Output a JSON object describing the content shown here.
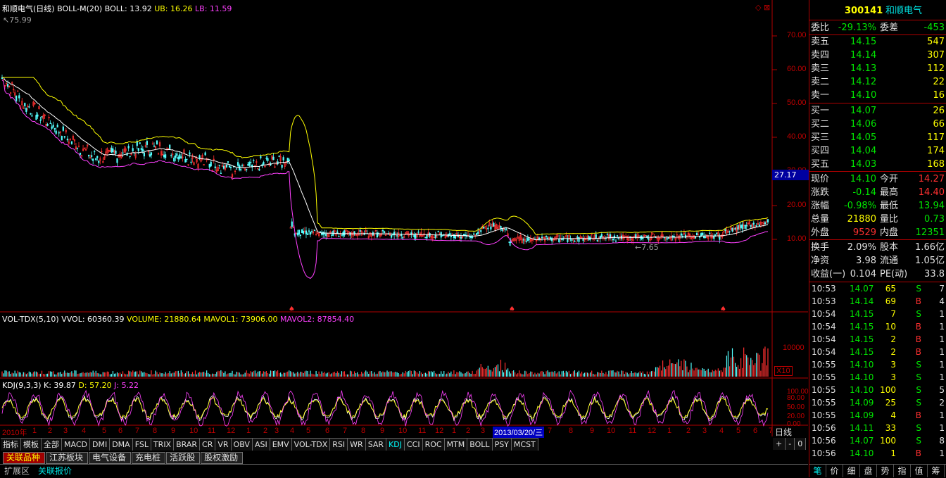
{
  "chart_header": {
    "name": "和顺电气(日线)",
    "indicator": "BOLL-M(20)",
    "boll_label": "BOLL:",
    "boll_value": "13.92",
    "ub_label": "UB:",
    "ub_value": "16.26",
    "lb_label": "LB:",
    "lb_value": "11.59",
    "high_marker": "75.99",
    "low_marker": "7.65",
    "current_price_tag": "27.17"
  },
  "price_axis": [
    "70.00",
    "60.00",
    "50.00",
    "40.00",
    "30.00",
    "20.00",
    "10.00"
  ],
  "vol_header": {
    "name": "VOL-TDX(5,10)",
    "vvol_label": "VVOL:",
    "vvol_value": "60360.39",
    "volume_label": "VOLUME:",
    "volume_value": "21880.64",
    "mavol1_label": "MAVOL1:",
    "mavol1_value": "73906.00",
    "mavol2_label": "MAVOL2:",
    "mavol2_value": "87854.40",
    "axis_value": "10000",
    "unit": "X10"
  },
  "kdj_header": {
    "name": "KDJ(9,3,3)",
    "k_label": "K:",
    "k_value": "39.87",
    "d_label": "D:",
    "d_value": "57.20",
    "j_label": "J:",
    "j_value": "5.22",
    "axis": [
      "100.00",
      "80.00",
      "50.00",
      "20.00",
      "0.00"
    ]
  },
  "time_axis": {
    "ticks": [
      "2010年",
      "1",
      "2",
      "3",
      "4",
      "5",
      "6",
      "7",
      "8",
      "9",
      "10",
      "11",
      "12",
      "1",
      "2",
      "3",
      "4",
      "5",
      "6",
      "7",
      "8",
      "9",
      "10",
      "11",
      "12",
      "1",
      "2",
      "3",
      "2013/03/20/三",
      "7",
      "8",
      "9",
      "10",
      "11",
      "12",
      "1",
      "2",
      "3",
      "4",
      "5",
      "6",
      "7"
    ],
    "period": "日线"
  },
  "indicator_tabs": [
    "指标",
    "模板",
    "全部",
    "MACD",
    "DMI",
    "DMA",
    "FSL",
    "TRIX",
    "BRAR",
    "CR",
    "VR",
    "OBV",
    "ASI",
    "EMV",
    "VOL-TDX",
    "RSI",
    "WR",
    "SAR",
    "KDJ",
    "CCI",
    "ROC",
    "MTM",
    "BOLL",
    "PSY",
    "MCST"
  ],
  "zoom_controls": [
    "+",
    "-",
    "0"
  ],
  "board_tabs": [
    "关联品种",
    "江苏板块",
    "电气设备",
    "充电桩",
    "活跃股",
    "股权激励"
  ],
  "footer_tabs": [
    "扩展区",
    "关联报价"
  ],
  "quote": {
    "code": "300141",
    "name": "和顺电气",
    "weibi_label": "委比",
    "weibi": "-29.13%",
    "weicha_label": "委差",
    "weicha": "-453",
    "sell": [
      {
        "label": "卖五",
        "price": "14.15",
        "vol": "547"
      },
      {
        "label": "卖四",
        "price": "14.14",
        "vol": "307"
      },
      {
        "label": "卖三",
        "price": "14.13",
        "vol": "112"
      },
      {
        "label": "卖二",
        "price": "14.12",
        "vol": "22"
      },
      {
        "label": "卖一",
        "price": "14.10",
        "vol": "16"
      }
    ],
    "buy": [
      {
        "label": "买一",
        "price": "14.07",
        "vol": "26"
      },
      {
        "label": "买二",
        "price": "14.06",
        "vol": "66"
      },
      {
        "label": "买三",
        "price": "14.05",
        "vol": "117"
      },
      {
        "label": "买四",
        "price": "14.04",
        "vol": "174"
      },
      {
        "label": "买五",
        "price": "14.03",
        "vol": "168"
      }
    ],
    "stats": [
      {
        "l1": "现价",
        "v1": "14.10",
        "c1": "#00e600",
        "l2": "今开",
        "v2": "14.27",
        "c2": "#ff3030"
      },
      {
        "l1": "涨跌",
        "v1": "-0.14",
        "c1": "#00e600",
        "l2": "最高",
        "v2": "14.40",
        "c2": "#ff3030"
      },
      {
        "l1": "涨幅",
        "v1": "-0.98%",
        "c1": "#00e600",
        "l2": "最低",
        "v2": "13.94",
        "c2": "#00e600"
      },
      {
        "l1": "总量",
        "v1": "21880",
        "c1": "#ffff00",
        "l2": "量比",
        "v2": "0.73",
        "c2": "#00e600"
      },
      {
        "l1": "外盘",
        "v1": "9529",
        "c1": "#ff3030",
        "l2": "内盘",
        "v2": "12351",
        "c2": "#00e600"
      }
    ],
    "fund": [
      {
        "l1": "换手",
        "v1": "2.09%",
        "l2": "股本",
        "v2": "1.66亿"
      },
      {
        "l1": "净资",
        "v1": "3.98",
        "l2": "流通",
        "v2": "1.05亿"
      },
      {
        "l1": "收益(一)",
        "v1": "0.104",
        "l2": "PE(动)",
        "v2": "33.8"
      }
    ]
  },
  "ticks_list": [
    {
      "time": "10:53",
      "price": "14.07",
      "vol": "65",
      "bs": "S",
      "n": "7"
    },
    {
      "time": "10:53",
      "price": "14.14",
      "vol": "69",
      "bs": "B",
      "n": "4"
    },
    {
      "time": "10:54",
      "price": "14.15",
      "vol": "7",
      "bs": "S",
      "n": "1"
    },
    {
      "time": "10:54",
      "price": "14.15",
      "vol": "10",
      "bs": "B",
      "n": "1"
    },
    {
      "time": "10:54",
      "price": "14.15",
      "vol": "2",
      "bs": "B",
      "n": "1"
    },
    {
      "time": "10:54",
      "price": "14.15",
      "vol": "2",
      "bs": "B",
      "n": "1"
    },
    {
      "time": "10:55",
      "price": "14.10",
      "vol": "3",
      "bs": "S",
      "n": "1"
    },
    {
      "time": "10:55",
      "price": "14.10",
      "vol": "3",
      "bs": "S",
      "n": "1"
    },
    {
      "time": "10:55",
      "price": "14.10",
      "vol": "100",
      "bs": "S",
      "n": "5"
    },
    {
      "time": "10:55",
      "price": "14.09",
      "vol": "25",
      "bs": "S",
      "n": "2"
    },
    {
      "time": "10:55",
      "price": "14.09",
      "vol": "4",
      "bs": "B",
      "n": "1"
    },
    {
      "time": "10:56",
      "price": "14.11",
      "vol": "33",
      "bs": "S",
      "n": "1"
    },
    {
      "time": "10:56",
      "price": "14.07",
      "vol": "100",
      "bs": "S",
      "n": "8"
    },
    {
      "time": "10:56",
      "price": "14.10",
      "vol": "1",
      "bs": "B",
      "n": "1"
    }
  ],
  "bottom_tools": [
    "笔",
    "价",
    "细",
    "盘",
    "势",
    "指",
    "值",
    "筹"
  ],
  "colors": {
    "up": "#ff3030",
    "down": "#00e600",
    "boll_mid": "#ffffff",
    "boll_ub": "#ffff00",
    "boll_lb": "#ff40ff",
    "grid": "#b00000"
  }
}
